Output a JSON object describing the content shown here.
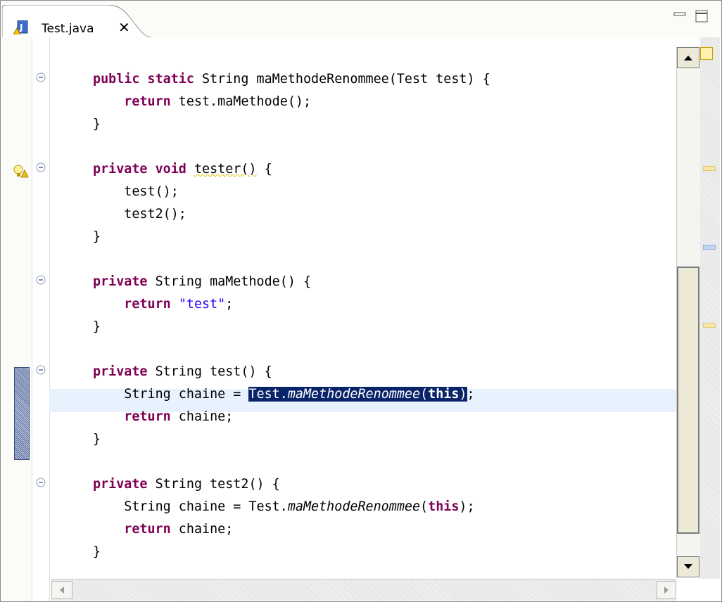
{
  "tab": {
    "title": "Test.java",
    "close_glyph": "✕",
    "icon": "java-file-warning-icon"
  },
  "window_controls": {
    "minimize_icon": "minimize-icon",
    "maximize_icon": "maximize-icon"
  },
  "code_lines": [
    {
      "segments": [
        {
          "t": "public static",
          "c": "kw"
        },
        {
          "t": " String maMethodeRenommee(Test test) {"
        }
      ]
    },
    {
      "segments": [
        {
          "t": "    "
        },
        {
          "t": "return",
          "c": "kw"
        },
        {
          "t": " test.maMethode();"
        }
      ]
    },
    {
      "segments": [
        {
          "t": "}"
        }
      ]
    },
    {
      "segments": [
        {
          "t": "private void",
          "c": "kw"
        },
        {
          "t": " "
        },
        {
          "t": "tester()",
          "c": "warn-underline"
        },
        {
          "t": " {"
        }
      ]
    },
    {
      "segments": [
        {
          "t": "    test();"
        }
      ]
    },
    {
      "segments": [
        {
          "t": "    test2();"
        }
      ]
    },
    {
      "segments": [
        {
          "t": "}"
        }
      ]
    },
    {
      "segments": [
        {
          "t": "private",
          "c": "kw"
        },
        {
          "t": " String maMethode() {"
        }
      ]
    },
    {
      "segments": [
        {
          "t": "    "
        },
        {
          "t": "return",
          "c": "kw"
        },
        {
          "t": " "
        },
        {
          "t": "\"test\"",
          "c": "str"
        },
        {
          "t": ";"
        }
      ]
    },
    {
      "segments": [
        {
          "t": "}"
        }
      ]
    },
    {
      "segments": [
        {
          "t": "private",
          "c": "kw"
        },
        {
          "t": " String test() {"
        }
      ]
    },
    {
      "segments": [
        {
          "t": "    String chaine = "
        },
        {
          "t": "Test.",
          "c": "sel"
        },
        {
          "t": "maMethodeRenommee",
          "c": "sel it"
        },
        {
          "t": "(",
          "c": "sel"
        },
        {
          "t": "this",
          "c": "sel kw-sel"
        },
        {
          "t": ")",
          "c": "sel"
        },
        {
          "t": ";"
        }
      ]
    },
    {
      "segments": [
        {
          "t": "    "
        },
        {
          "t": "return",
          "c": "kw"
        },
        {
          "t": " chaine;"
        }
      ]
    },
    {
      "segments": [
        {
          "t": "}"
        }
      ]
    },
    {
      "segments": [
        {
          "t": "private",
          "c": "kw"
        },
        {
          "t": " String test2() {"
        }
      ]
    },
    {
      "segments": [
        {
          "t": "    String chaine = Test."
        },
        {
          "t": "maMethodeRenommee",
          "c": "it"
        },
        {
          "t": "("
        },
        {
          "t": "this",
          "c": "kw"
        },
        {
          "t": ");"
        }
      ]
    },
    {
      "segments": [
        {
          "t": "    "
        },
        {
          "t": "return",
          "c": "kw"
        },
        {
          "t": " chaine;"
        }
      ]
    },
    {
      "segments": [
        {
          "t": "}"
        }
      ]
    }
  ],
  "markers": {
    "warning": "warning-lightbulb-icon",
    "fold": "fold-collapse-icon"
  },
  "colors": {
    "keyword": "#7f0055",
    "string": "#2a00ff",
    "selection": "#0a246a",
    "current_line": "#e8f2fe"
  }
}
